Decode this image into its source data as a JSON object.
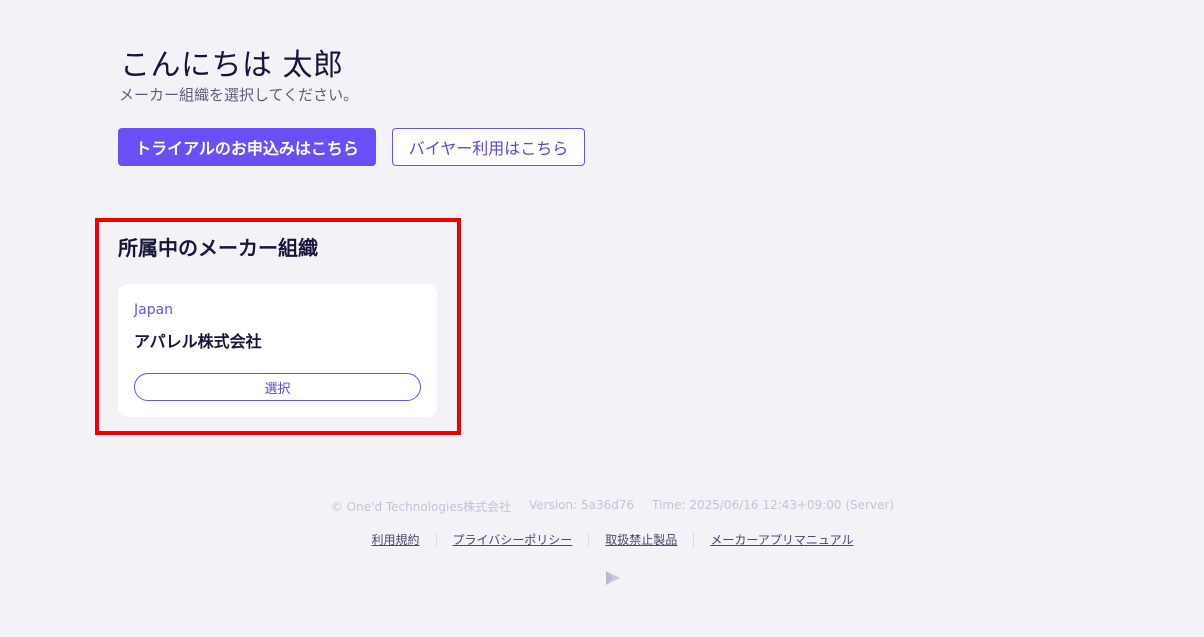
{
  "header": {
    "greeting": "こんにちは 太郎",
    "subtitle": "メーカー組織を選択してください。"
  },
  "actions": {
    "trial_label": "トライアルのお申込みはこちら",
    "buyer_label": "バイヤー利用はこちら"
  },
  "organizations": {
    "title": "所属中のメーカー組織",
    "items": [
      {
        "country": "Japan",
        "name": "アパレル株式会社",
        "select_label": "選択"
      }
    ]
  },
  "footer": {
    "copyright": "© One'd Technologies株式会社",
    "version": "Version: 5a36d76",
    "time": "Time: 2025/06/16 12:43+09:00 (Server)",
    "links": [
      "利用規約",
      "プライバシーポリシー",
      "取扱禁止製品",
      "メーカーアプリマニュアル"
    ],
    "logo_icon": "play-logo-icon"
  },
  "colors": {
    "accent": "#6a4ff7",
    "background": "#f3f2f7",
    "highlight": "#ee0000"
  }
}
